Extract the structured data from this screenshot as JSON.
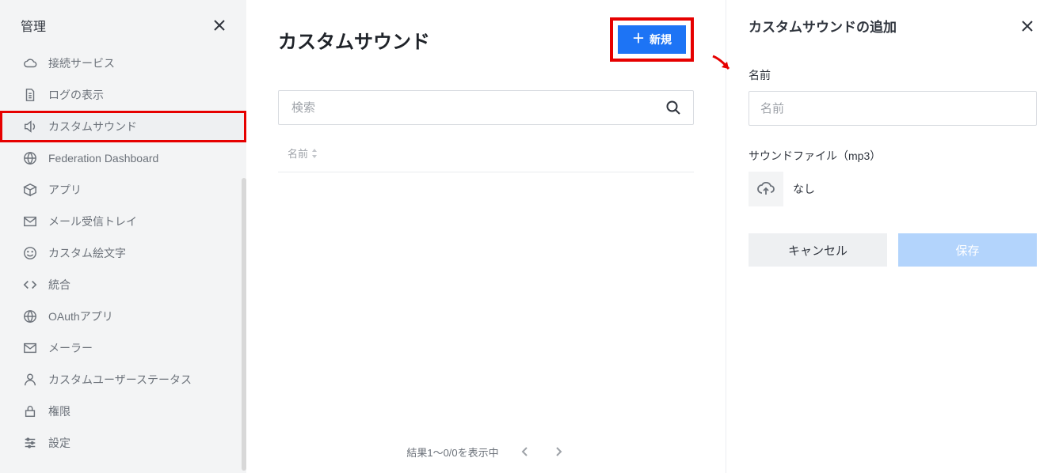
{
  "sidebar": {
    "title": "管理",
    "items": [
      {
        "id": "connected-services",
        "label": "接続サービス",
        "icon": "cloud"
      },
      {
        "id": "view-logs",
        "label": "ログの表示",
        "icon": "doc"
      },
      {
        "id": "custom-sounds",
        "label": "カスタムサウンド",
        "icon": "sound",
        "active": true,
        "highlight": true
      },
      {
        "id": "federation-dashboard",
        "label": "Federation Dashboard",
        "icon": "globe"
      },
      {
        "id": "apps",
        "label": "アプリ",
        "icon": "cube"
      },
      {
        "id": "email-inboxes",
        "label": "メール受信トレイ",
        "icon": "mail"
      },
      {
        "id": "custom-emoji",
        "label": "カスタム絵文字",
        "icon": "emoji"
      },
      {
        "id": "integrations",
        "label": "統合",
        "icon": "code"
      },
      {
        "id": "oauth-apps",
        "label": "OAuthアプリ",
        "icon": "globe"
      },
      {
        "id": "mailer",
        "label": "メーラー",
        "icon": "mail"
      },
      {
        "id": "custom-user-status",
        "label": "カスタムユーザーステータス",
        "icon": "user"
      },
      {
        "id": "permissions",
        "label": "権限",
        "icon": "lock"
      },
      {
        "id": "settings",
        "label": "設定",
        "icon": "sliders"
      }
    ]
  },
  "main": {
    "title": "カスタムサウンド",
    "new_button": {
      "plus": "＋",
      "label": "新規"
    },
    "search_placeholder": "検索",
    "columns": {
      "name": "名前"
    },
    "pager": {
      "text": "結果1～0/0を表示中"
    }
  },
  "panel": {
    "title": "カスタムサウンドの追加",
    "name_label": "名前",
    "name_placeholder": "名前",
    "file_label": "サウンドファイル（mp3）",
    "file_status": "なし",
    "cancel": "キャンセル",
    "save": "保存"
  }
}
